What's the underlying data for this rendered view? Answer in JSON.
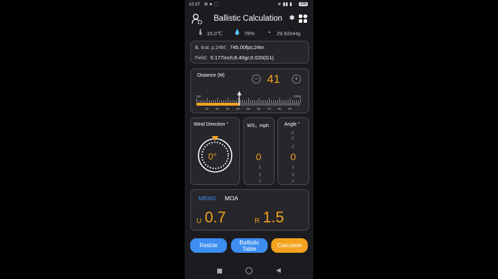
{
  "status": {
    "time": "10:37",
    "battery": "100"
  },
  "header": {
    "title": "Ballistic Calculation"
  },
  "weather": {
    "temperature": "15.0℃",
    "humidity": "78%",
    "pressure": "29.92inHg"
  },
  "profile": {
    "line1_label": "B. kral. p.24M：",
    "line1_value": "745.00fps;24m",
    "line2_label": "Field：",
    "line2_value": "0.177inch;8.40gr;0.020(G1)"
  },
  "distance": {
    "label": "Distance (M)",
    "value": "41",
    "minus": "−",
    "plus": "+",
    "ruler_min": "0M",
    "ruler_max": "100M",
    "ticks": [
      "10",
      "20",
      "30",
      "40",
      "50",
      "60",
      "70",
      "80",
      "90"
    ],
    "fill_fraction": 0.41
  },
  "wind_direction": {
    "label": "Wind Direction °",
    "value": "0°"
  },
  "wind_speed": {
    "label": "WS，mph",
    "value": "0",
    "below": [
      "1",
      "2",
      "3"
    ]
  },
  "angle": {
    "label": "Angle °",
    "above": [
      "-3",
      "-2",
      "-1"
    ],
    "value": "0",
    "below": [
      "1",
      "2",
      "3"
    ]
  },
  "units": {
    "mrad": "MRAD",
    "moa": "MOA",
    "up_label": "U",
    "up_value": "0.7",
    "right_label": "R",
    "right_value": "1.5"
  },
  "buttons": {
    "reticle": "Reticle",
    "ballistic_table_1": "Ballistic",
    "ballistic_table_2": "Table",
    "calculate": "Calculate"
  },
  "colors": {
    "accent": "#f4a21f",
    "button_blue": "#3d8ef0",
    "background": "#1c1c20"
  }
}
